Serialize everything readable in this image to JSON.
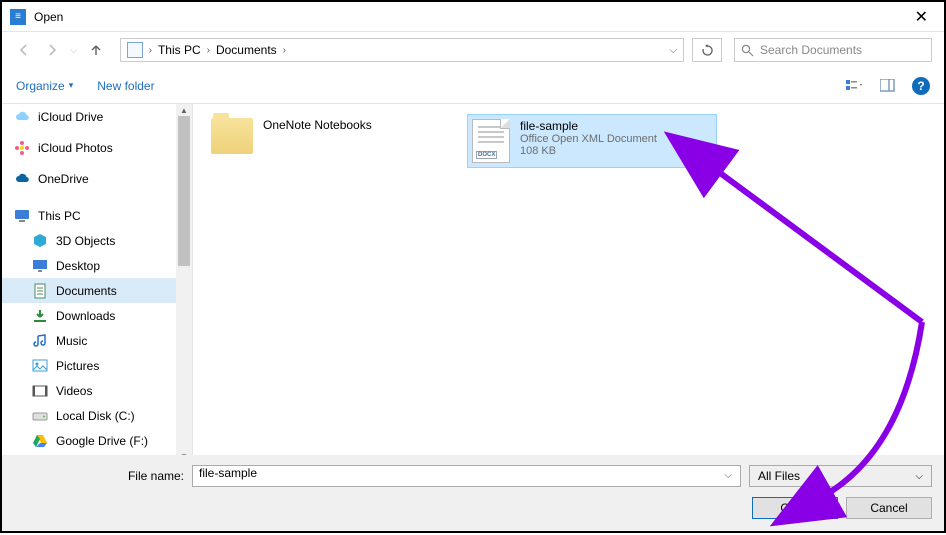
{
  "titlebar": {
    "title": "Open"
  },
  "nav": {
    "breadcrumb": {
      "root": "This PC",
      "current": "Documents"
    },
    "search_placeholder": "Search Documents"
  },
  "toolbar": {
    "organize_label": "Organize",
    "newfolder_label": "New folder"
  },
  "sidebar": {
    "items": [
      {
        "label": "iCloud Drive",
        "indent": 0,
        "icon": "cloud",
        "color": "#8ed0ff"
      },
      {
        "label": "iCloud Photos",
        "indent": 0,
        "icon": "flower",
        "color": "#f25c8e"
      },
      {
        "label": "OneDrive",
        "indent": 0,
        "icon": "cloud",
        "color": "#0a64a0"
      },
      {
        "label": "This PC",
        "indent": 0,
        "icon": "monitor",
        "color": "#3b7dd8"
      },
      {
        "label": "3D Objects",
        "indent": 1,
        "icon": "cube",
        "color": "#2fa9d6"
      },
      {
        "label": "Desktop",
        "indent": 1,
        "icon": "desktop",
        "color": "#3b7dd8"
      },
      {
        "label": "Documents",
        "indent": 1,
        "icon": "doc",
        "color": "#4c8a62",
        "selected": true
      },
      {
        "label": "Downloads",
        "indent": 1,
        "icon": "download",
        "color": "#2e8b3e"
      },
      {
        "label": "Music",
        "indent": 1,
        "icon": "music",
        "color": "#2170c9"
      },
      {
        "label": "Pictures",
        "indent": 1,
        "icon": "picture",
        "color": "#39a0d6"
      },
      {
        "label": "Videos",
        "indent": 1,
        "icon": "video",
        "color": "#555"
      },
      {
        "label": "Local Disk (C:)",
        "indent": 1,
        "icon": "disk",
        "color": "#9a9a9a"
      },
      {
        "label": "Google Drive (F:)",
        "indent": 1,
        "icon": "gdrive",
        "color": "#1fa463"
      }
    ]
  },
  "content": {
    "folder": {
      "name": "OneNote Notebooks"
    },
    "file": {
      "name": "file-sample",
      "type": "Office Open XML Document",
      "size": "108 KB",
      "badge": "DOCX"
    }
  },
  "bottom": {
    "filename_label": "File name:",
    "filename_value": "file-sample",
    "filter_label": "All Files",
    "open_label": "Open",
    "cancel_label": "Cancel"
  }
}
